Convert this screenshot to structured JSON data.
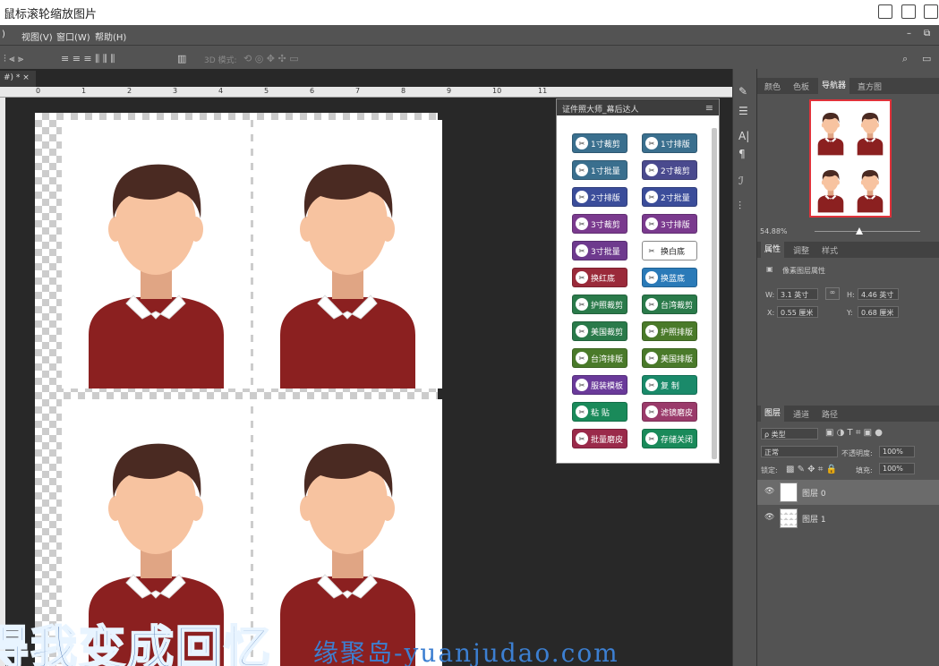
{
  "window": {
    "title": "鼠标滚轮缩放图片"
  },
  "menu": {
    "items": [
      ")",
      "视图(V)",
      "窗口(W)",
      "帮助(H)"
    ]
  },
  "options": {
    "mode_3d": "3D 模式:"
  },
  "doc": {
    "tab": "#) * ×"
  },
  "ruler": {
    "ticks": [
      "0",
      "1",
      "2",
      "3",
      "4",
      "5",
      "6",
      "7",
      "8",
      "9",
      "10",
      "11"
    ]
  },
  "plugin": {
    "title": "证件照大师_幕后达人",
    "buttons": [
      {
        "label": "1寸裁剪",
        "color": "#3a6f8e"
      },
      {
        "label": "1寸排版",
        "color": "#3a6f8e"
      },
      {
        "label": "1寸批量",
        "color": "#3a6f8e"
      },
      {
        "label": "2寸裁剪",
        "color": "#4a4a8e"
      },
      {
        "label": "2寸排版",
        "color": "#3b4d9a"
      },
      {
        "label": "2寸批量",
        "color": "#3b4d9a"
      },
      {
        "label": "3寸裁剪",
        "color": "#7a3a8e"
      },
      {
        "label": "3寸排版",
        "color": "#7a3a8e"
      },
      {
        "label": "3寸批量",
        "color": "#6e3a8e"
      },
      {
        "label": "换白底",
        "color": "#ffffff"
      },
      {
        "label": "换红底",
        "color": "#9a2a3a"
      },
      {
        "label": "换蓝底",
        "color": "#2a7ab8"
      },
      {
        "label": "护照裁剪",
        "color": "#2a7a4a"
      },
      {
        "label": "台湾裁剪",
        "color": "#2a7a4a"
      },
      {
        "label": "美国裁剪",
        "color": "#2a7a4a"
      },
      {
        "label": "护照排版",
        "color": "#4a7a2a"
      },
      {
        "label": "台湾排版",
        "color": "#4a7a2a"
      },
      {
        "label": "美国排版",
        "color": "#4a7a2a"
      },
      {
        "label": "服装模板",
        "color": "#6a3a9a"
      },
      {
        "label": "复 制",
        "color": "#1a8a6a"
      },
      {
        "label": "粘 贴",
        "color": "#1a8a5a"
      },
      {
        "label": "滤镜磨皮",
        "color": "#9a3a6a"
      },
      {
        "label": "批量磨皮",
        "color": "#9a2a4a"
      },
      {
        "label": "存储关闭",
        "color": "#1a8a5a"
      }
    ]
  },
  "panels": {
    "tabs1": [
      "颜色",
      "色板",
      "导航器",
      "直方图"
    ],
    "zoom": "54.88%",
    "tabs2": [
      "属性",
      "调整",
      "样式"
    ],
    "props_title": "像素图层属性",
    "w_label": "W:",
    "w_value": "3.1 英寸",
    "h_label": "H:",
    "h_value": "4.46 英寸",
    "x_label": "X:",
    "x_value": "0.55 厘米",
    "y_label": "Y:",
    "y_value": "0.68 厘米",
    "tabs3": [
      "图层",
      "通道",
      "路径"
    ],
    "kind": "ρ 类型",
    "blend": "正常",
    "opacity_label": "不透明度:",
    "opacity": "100%",
    "lock_label": "锁定:",
    "fill_label": "填充:",
    "fill": "100%",
    "layers": [
      "图层 0",
      "图层 1"
    ]
  },
  "watermark": {
    "big": "得我变成回忆",
    "site": "缘聚岛-yuanjudao.com"
  },
  "colors": {
    "sweater": "#8b2020",
    "hair": "#4a2a22",
    "skin": "#f7c3a0",
    "collar": "#ffffff"
  }
}
